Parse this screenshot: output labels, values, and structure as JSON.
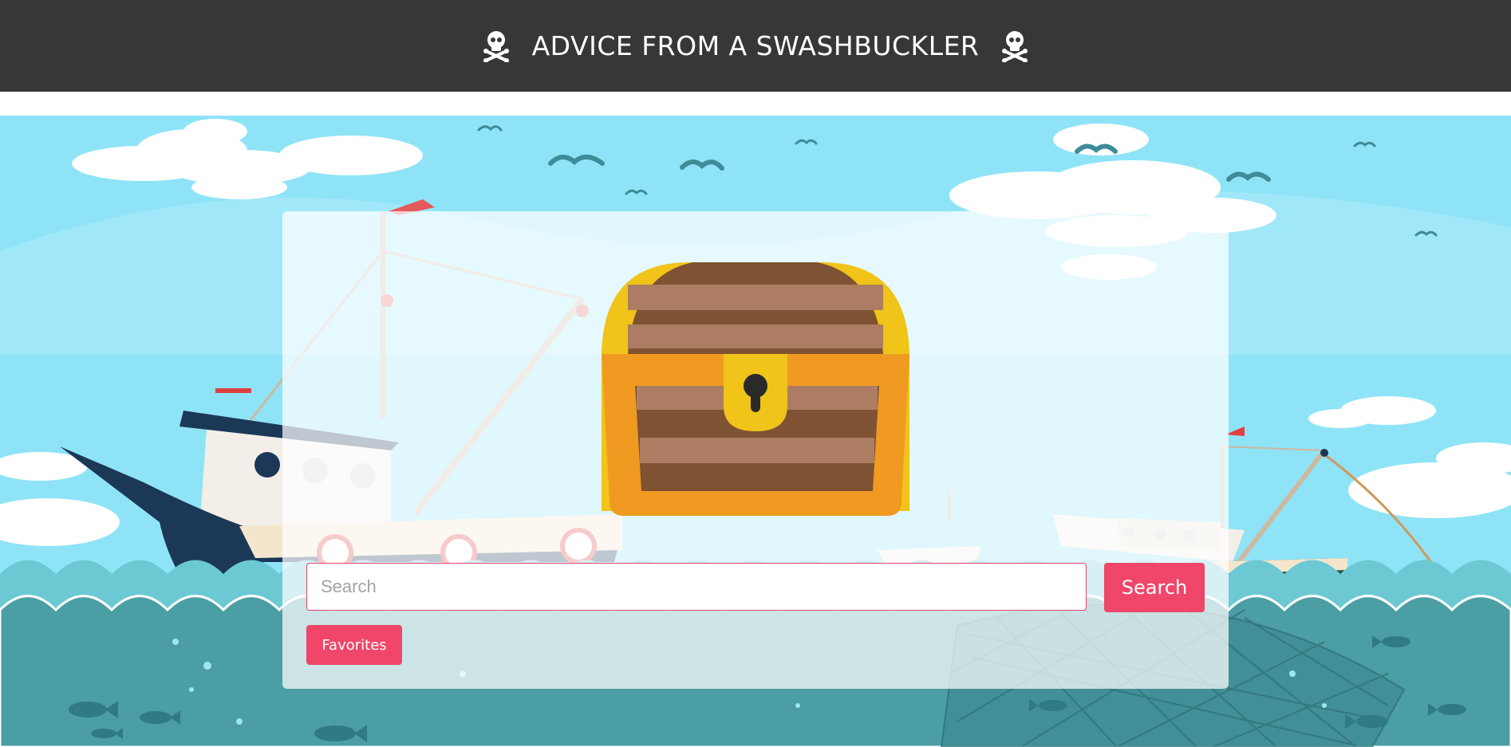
{
  "header": {
    "title": "ADVICE FROM A SWASHBUCKLER",
    "left_icon": "skull-crossbones-icon",
    "right_icon": "skull-crossbones-icon"
  },
  "background": {
    "description_icons": [
      "sky",
      "clouds",
      "seagulls",
      "fishing-boats",
      "sea-waves",
      "fishing-net",
      "fish"
    ]
  },
  "main": {
    "illustration": "treasure-chest-icon",
    "search": {
      "placeholder": "Search",
      "value": "",
      "button_label": "Search"
    },
    "favorites_label": "Favorites"
  },
  "colors": {
    "header_bg": "#373737",
    "accent": "#ef4669",
    "sky": "#8fe3f7",
    "sea": "#4b9ea4",
    "chest_wood": "#7f5233",
    "chest_gold": "#f09a22"
  }
}
